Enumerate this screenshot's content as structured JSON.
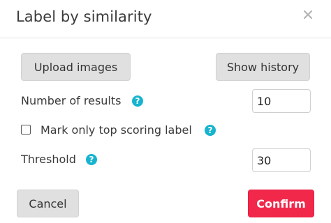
{
  "dialog": {
    "title": "Label by similarity",
    "close_icon": "close-icon"
  },
  "buttons": {
    "upload_label": "Upload images",
    "history_label": "Show history",
    "cancel_label": "Cancel",
    "confirm_label": "Confirm"
  },
  "fields": {
    "num_results": {
      "label": "Number of results",
      "value": "10",
      "help_glyph": "?"
    },
    "top_label": {
      "label": "Mark only top scoring label",
      "checked": false,
      "help_glyph": "?"
    },
    "threshold": {
      "label": "Threshold",
      "value": "30",
      "help_glyph": "?"
    }
  },
  "colors": {
    "accent": "#17b3cf",
    "confirm": "#f2284b",
    "button_grey": "#e0e0e0"
  }
}
